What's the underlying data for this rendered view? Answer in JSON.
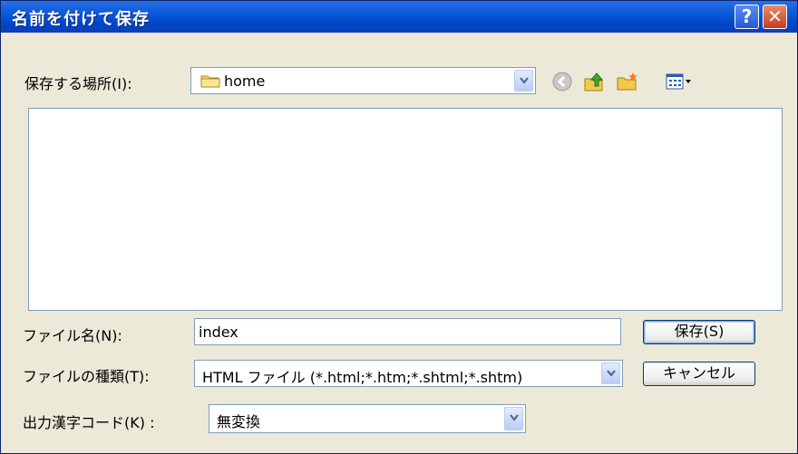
{
  "window": {
    "title": "名前を付けて保存"
  },
  "titlebar": {
    "help_label": "?",
    "close_label": "✕"
  },
  "location": {
    "label": "保存する場所(I):",
    "value": "home"
  },
  "filename": {
    "label": "ファイル名(N):",
    "value": "index"
  },
  "filetype": {
    "label": "ファイルの種類(T):",
    "value": "HTML ファイル (*.html;*.htm;*.shtml;*.shtm)"
  },
  "encoding": {
    "label": "出力漢字コード(K) :",
    "value": "無変換"
  },
  "buttons": {
    "save": "保存(S)",
    "cancel": "キャンセル"
  },
  "toolbar": {
    "icons": [
      "back-icon",
      "up-folder-icon",
      "new-folder-icon",
      "view-menu-icon"
    ]
  },
  "colors": {
    "titlebar": "#0a5ad9",
    "background": "#ece9d8",
    "border": "#7f9db9"
  }
}
